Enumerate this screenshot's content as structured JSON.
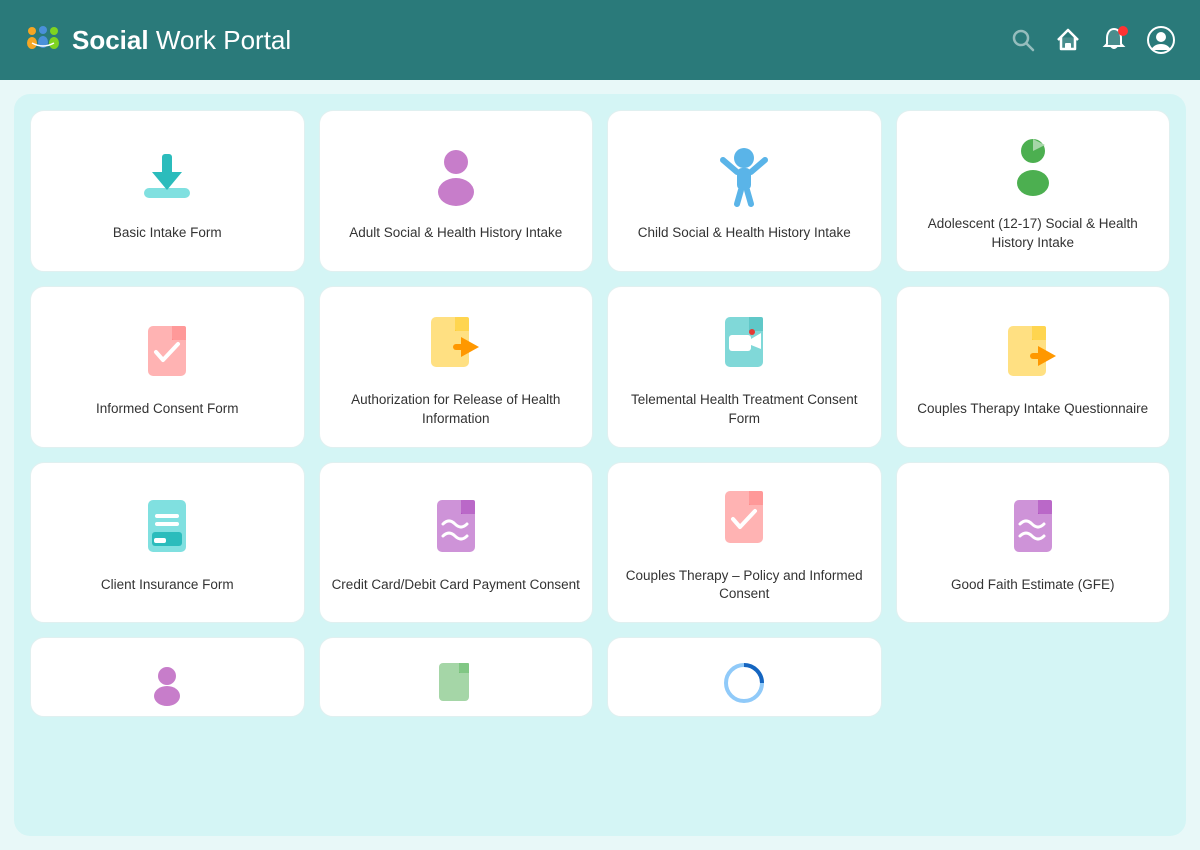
{
  "header": {
    "title_bold": "Social",
    "title_rest": " Work Portal",
    "logo_emoji": "🤝"
  },
  "cards": [
    {
      "id": "basic-intake",
      "label": "Basic Intake Form",
      "icon": "download"
    },
    {
      "id": "adult-social",
      "label": "Adult Social & Health History Intake",
      "icon": "person-purple"
    },
    {
      "id": "child-social",
      "label": "Child Social & Health History Intake",
      "icon": "person-blue-child"
    },
    {
      "id": "adolescent-social",
      "label": "Adolescent (12-17) Social & Health History Intake",
      "icon": "person-green"
    },
    {
      "id": "informed-consent",
      "label": "Informed Consent Form",
      "icon": "doc-pink-check"
    },
    {
      "id": "auth-release",
      "label": "Authorization for Release of Health Information",
      "icon": "doc-yellow-arrow"
    },
    {
      "id": "telemental",
      "label": "Telemental Health Treatment Consent Form",
      "icon": "doc-teal-video"
    },
    {
      "id": "couples-intake",
      "label": "Couples Therapy Intake Questionnaire",
      "icon": "doc-yellow-arrow2"
    },
    {
      "id": "client-insurance",
      "label": "Client Insurance Form",
      "icon": "doc-teal-list"
    },
    {
      "id": "credit-card",
      "label": "Credit Card/Debit Card Payment Consent",
      "icon": "doc-purple-squiggle"
    },
    {
      "id": "couples-policy",
      "label": "Couples Therapy – Policy and Informed Consent",
      "icon": "doc-pink-check2"
    },
    {
      "id": "good-faith",
      "label": "Good Faith Estimate (GFE)",
      "icon": "doc-purple-squiggle2"
    }
  ],
  "partial_cards": [
    {
      "id": "partial-1",
      "icon": "person-purple-partial"
    },
    {
      "id": "partial-2",
      "icon": "doc-green-partial"
    },
    {
      "id": "partial-3",
      "icon": "circle-blue-partial"
    }
  ]
}
